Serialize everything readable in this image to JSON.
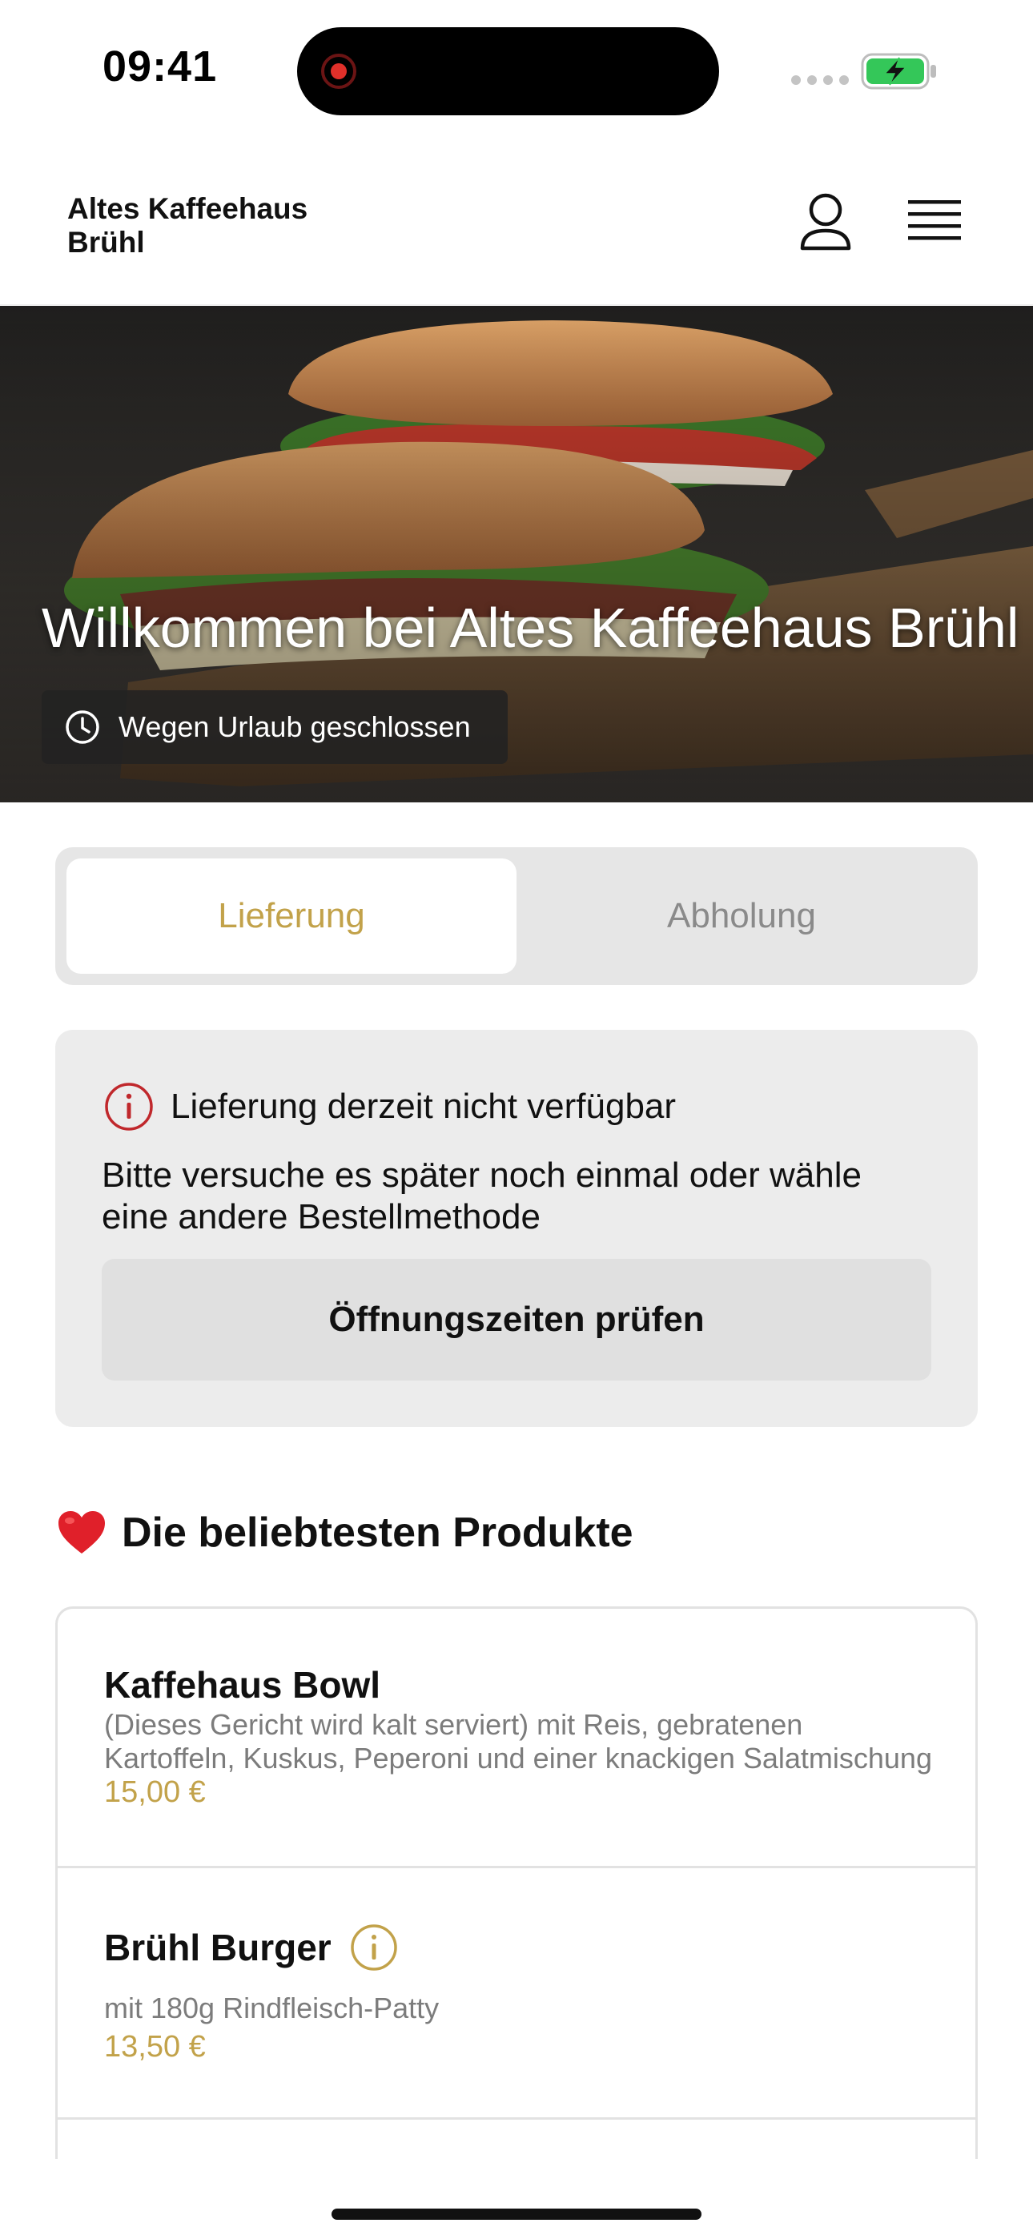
{
  "status_bar": {
    "time": "09:41",
    "battery_color": "#34c759"
  },
  "header": {
    "brand": "Altes Kaffeehaus Brühl",
    "user_icon": "user-icon",
    "menu_icon": "hamburger-menu-icon"
  },
  "hero": {
    "title": "Willkommen bei Altes Kaffeehaus Brühl",
    "status": "Wegen Urlaub geschlossen"
  },
  "tabs": {
    "delivery": "Lieferung",
    "pickup": "Abholung",
    "active": "delivery"
  },
  "alert": {
    "title": "Lieferung derzeit nicht verfügbar",
    "text": "Bitte versuche es später noch einmal oder wähle eine andere Bestellmethode",
    "button": "Öffnungszeiten prüfen"
  },
  "popular": {
    "title": "Die beliebtesten Produkte",
    "products": [
      {
        "name": "Kaffehaus Bowl",
        "description": "(Dieses Gericht wird kalt serviert) mit Reis, gebratenen Kartoffeln, Kuskus, Peperoni und einer knackigen Salatmischung",
        "price": "15,00 €"
      },
      {
        "name": "Brühl Burger",
        "description": "mit 180g Rindfleisch-Patty",
        "price": "13,50 €"
      }
    ]
  },
  "colors": {
    "accent": "#c2a24a",
    "alert_icon": "#c0282c"
  }
}
